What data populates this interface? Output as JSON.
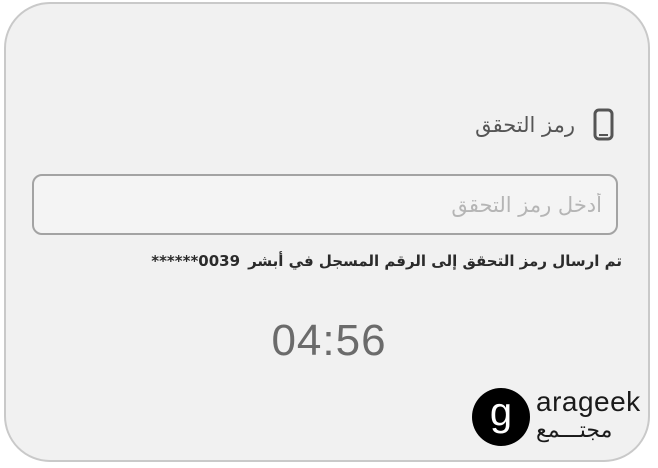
{
  "otp": {
    "title": "رمز التحقق",
    "icon": "mobile-phone-icon",
    "input_placeholder": "أدخل رمز التحقق",
    "input_value": "",
    "sent_message": "تم ارسال رمز التحقق إلى الرقم المسجل في أبشر",
    "masked_number": "******0039",
    "countdown": "04:56"
  },
  "watermark": {
    "logo_letter": "g",
    "brand_latin": "arageek",
    "brand_arabic": "مجتـــمع"
  },
  "colors": {
    "card_background": "#f1f1f1",
    "card_border": "#c9c9c9",
    "input_border": "#a3a3a3",
    "timer_text": "#6b6b6b"
  }
}
